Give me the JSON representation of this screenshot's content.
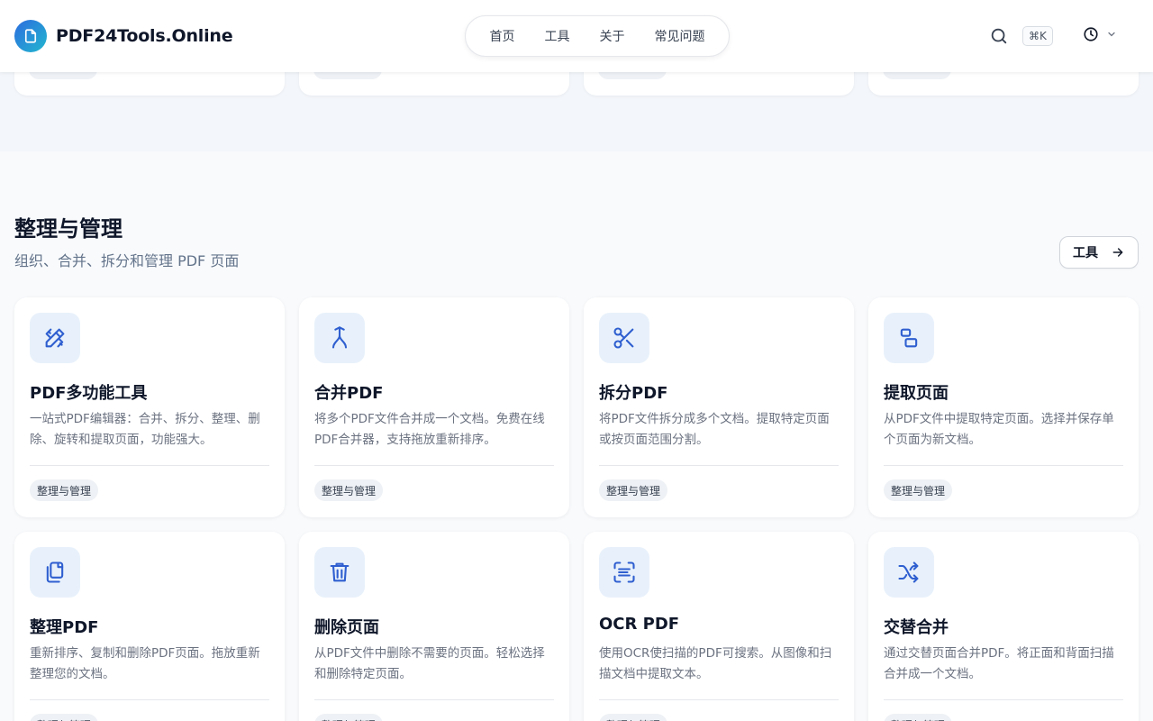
{
  "header": {
    "brand": "PDF24Tools.Online",
    "nav": [
      {
        "label": "首页"
      },
      {
        "label": "工具"
      },
      {
        "label": "关于"
      },
      {
        "label": "常见问题"
      }
    ],
    "search_shortcut": "⌘K"
  },
  "section": {
    "title": "整理与管理",
    "subtitle": "组织、合并、拆分和管理 PDF 页面",
    "tools_link_label": "工具"
  },
  "cards": [
    {
      "icon": "pencil-ruler-icon",
      "title": "PDF多功能工具",
      "desc": "一站式PDF编辑器：合并、拆分、整理、删除、旋转和提取页面，功能强大。",
      "tag": "整理与管理"
    },
    {
      "icon": "merge-icon",
      "title": "合并PDF",
      "desc": "将多个PDF文件合并成一个文档。免费在线PDF合并器，支持拖放重新排序。",
      "tag": "整理与管理"
    },
    {
      "icon": "scissors-icon",
      "title": "拆分PDF",
      "desc": "将PDF文件拆分成多个文档。提取特定页面或按页面范围分割。",
      "tag": "整理与管理"
    },
    {
      "icon": "extract-pages-icon",
      "title": "提取页面",
      "desc": "从PDF文件中提取特定页面。选择并保存单个页面为新文档。",
      "tag": "整理与管理"
    },
    {
      "icon": "copy-pages-icon",
      "title": "整理PDF",
      "desc": "重新排序、复制和删除PDF页面。拖放重新整理您的文档。",
      "tag": "整理与管理"
    },
    {
      "icon": "trash-icon",
      "title": "删除页面",
      "desc": "从PDF文件中删除不需要的页面。轻松选择和删除特定页面。",
      "tag": "整理与管理"
    },
    {
      "icon": "scan-text-icon",
      "title": "OCR PDF",
      "desc": "使用OCR使扫描的PDF可搜索。从图像和扫描文档中提取文本。",
      "tag": "整理与管理"
    },
    {
      "icon": "shuffle-icon",
      "title": "交替合并",
      "desc": "通过交替页面合并PDF。将正面和背面扫描合并成一个文档。",
      "tag": "整理与管理"
    }
  ],
  "colors": {
    "accent": "#2563eb",
    "icon_bg": "#e8f1fb",
    "tag_bg": "#eef1f5"
  }
}
